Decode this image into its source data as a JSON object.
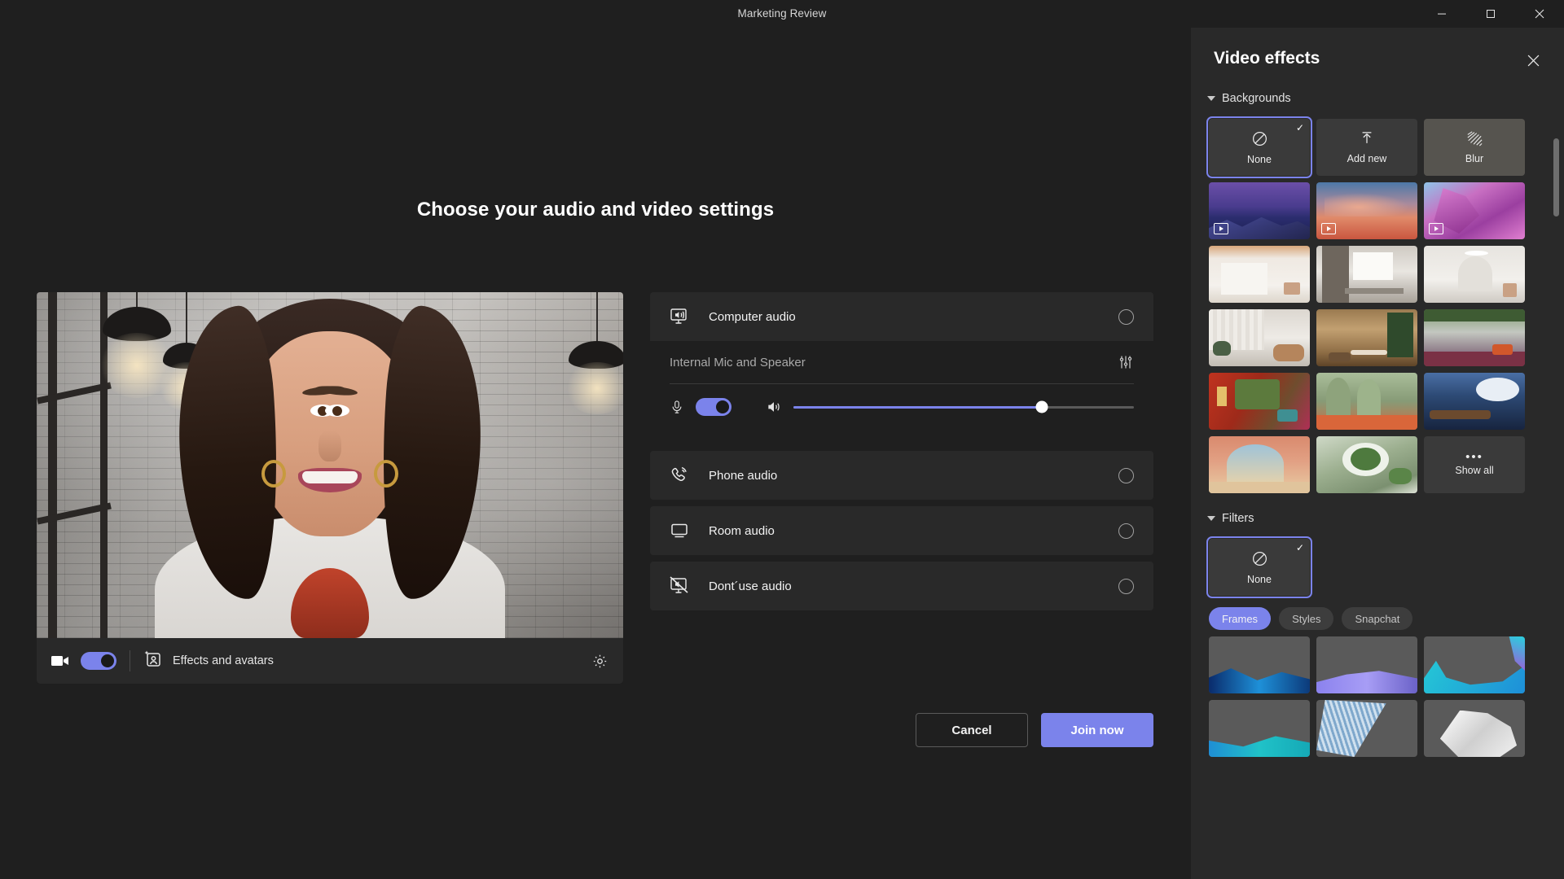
{
  "window": {
    "title": "Marketing Review",
    "minimize_label": "Minimize",
    "maximize_label": "Maximize",
    "close_label": "Close"
  },
  "stage": {
    "headline": "Choose your audio and video settings"
  },
  "preview": {
    "camera_toggle_state": "on",
    "effects_label": "Effects and avatars",
    "settings_label": "Device settings"
  },
  "audio": {
    "computer": {
      "label": "Computer audio",
      "selected": true,
      "device": "Internal Mic and Speaker",
      "mic_toggle_state": "on",
      "volume_percent": 73
    },
    "phone": {
      "label": "Phone audio",
      "selected": false
    },
    "room": {
      "label": "Room audio",
      "selected": false
    },
    "none": {
      "label": "Dont´use audio",
      "selected": false
    }
  },
  "actions": {
    "cancel": "Cancel",
    "join": "Join now"
  },
  "video_effects": {
    "title": "Video effects",
    "close_label": "Close",
    "backgrounds": {
      "section_label": "Backgrounds",
      "items": [
        {
          "label": "None",
          "type": "none",
          "selected": true
        },
        {
          "label": "Add new",
          "type": "add"
        },
        {
          "label": "Blur",
          "type": "blur"
        },
        {
          "label": "Purple mountains at dusk",
          "type": "video"
        },
        {
          "label": "Pink clouds over water",
          "type": "video"
        },
        {
          "label": "Magenta crystal formation",
          "type": "video"
        },
        {
          "label": "White minimal interior with wood ceiling",
          "type": "image"
        },
        {
          "label": "Modern office with tall windows",
          "type": "image"
        },
        {
          "label": "White arched gallery room",
          "type": "image"
        },
        {
          "label": "Neutral living room with curtains",
          "type": "image"
        },
        {
          "label": "Warm wood dining room with plants",
          "type": "image"
        },
        {
          "label": "Outdoor terrace with pergola",
          "type": "image"
        },
        {
          "label": "Red room with greenery and art",
          "type": "image"
        },
        {
          "label": "Green arches with orange flowers",
          "type": "image"
        },
        {
          "label": "Blue abstract lounge",
          "type": "image"
        },
        {
          "label": "Terracotta arch desert view",
          "type": "image"
        },
        {
          "label": "Green sculptural garden tunnel",
          "type": "image"
        },
        {
          "label": "Show all",
          "type": "more"
        }
      ]
    },
    "filters": {
      "section_label": "Filters",
      "none_label": "None",
      "none_selected": true,
      "tabs": [
        {
          "label": "Frames",
          "active": true
        },
        {
          "label": "Styles",
          "active": false
        },
        {
          "label": "Snapchat",
          "active": false
        }
      ],
      "frames": [
        {
          "label": "Blue wave frame"
        },
        {
          "label": "Purple wave frame"
        },
        {
          "label": "Teal ribbon corner frame"
        },
        {
          "label": "Teal gradient wave frame"
        },
        {
          "label": "Blue pleated fan frame"
        },
        {
          "label": "White low-poly crystal frame"
        }
      ]
    }
  },
  "colors": {
    "accent": "#7b83eb",
    "panel_bg": "#292929",
    "app_bg": "#1f1f1f",
    "text_primary": "#f2f2f2",
    "text_secondary": "#a9a9a9"
  }
}
